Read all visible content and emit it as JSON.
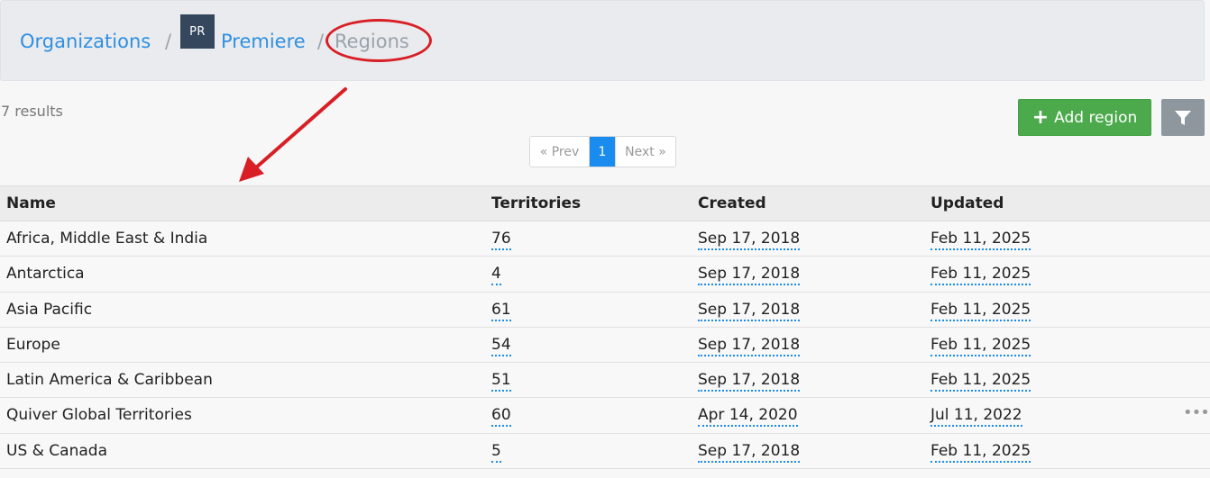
{
  "breadcrumb": {
    "organizations": "Organizations",
    "separator": "/",
    "org_avatar": "PR",
    "org_name": "Premiere",
    "current": "Regions"
  },
  "results": "7 results",
  "buttons": {
    "add_region": "Add region",
    "add_icon": "plus-icon",
    "filter_icon": "filter-icon"
  },
  "pagination": {
    "prev": "« Prev",
    "page": "1",
    "next": "Next »"
  },
  "table": {
    "headers": [
      "Name",
      "Territories",
      "Created",
      "Updated"
    ],
    "rows": [
      {
        "name": "Africa, Middle East & India",
        "territories": "76",
        "created": "Sep 17, 2018",
        "updated": "Feb 11, 2025"
      },
      {
        "name": "Antarctica",
        "territories": "4",
        "created": "Sep 17, 2018",
        "updated": "Feb 11, 2025"
      },
      {
        "name": "Asia Pacific",
        "territories": "61",
        "created": "Sep 17, 2018",
        "updated": "Feb 11, 2025"
      },
      {
        "name": "Europe",
        "territories": "54",
        "created": "Sep 17, 2018",
        "updated": "Feb 11, 2025"
      },
      {
        "name": "Latin America & Caribbean",
        "territories": "51",
        "created": "Sep 17, 2018",
        "updated": "Feb 11, 2025"
      },
      {
        "name": "Quiver Global Territories",
        "territories": "60",
        "created": "Apr 14, 2020",
        "updated": "Jul 11, 2022",
        "menu": "•••"
      },
      {
        "name": "US & Canada",
        "territories": "5",
        "created": "Sep 17, 2018",
        "updated": "Feb 11, 2025"
      }
    ]
  },
  "colors": {
    "link": "#2f8fe0",
    "add_button": "#4caa4c",
    "filter_button": "#8e969e",
    "annotation": "#d81f26",
    "active_page": "#1a8cf0"
  }
}
